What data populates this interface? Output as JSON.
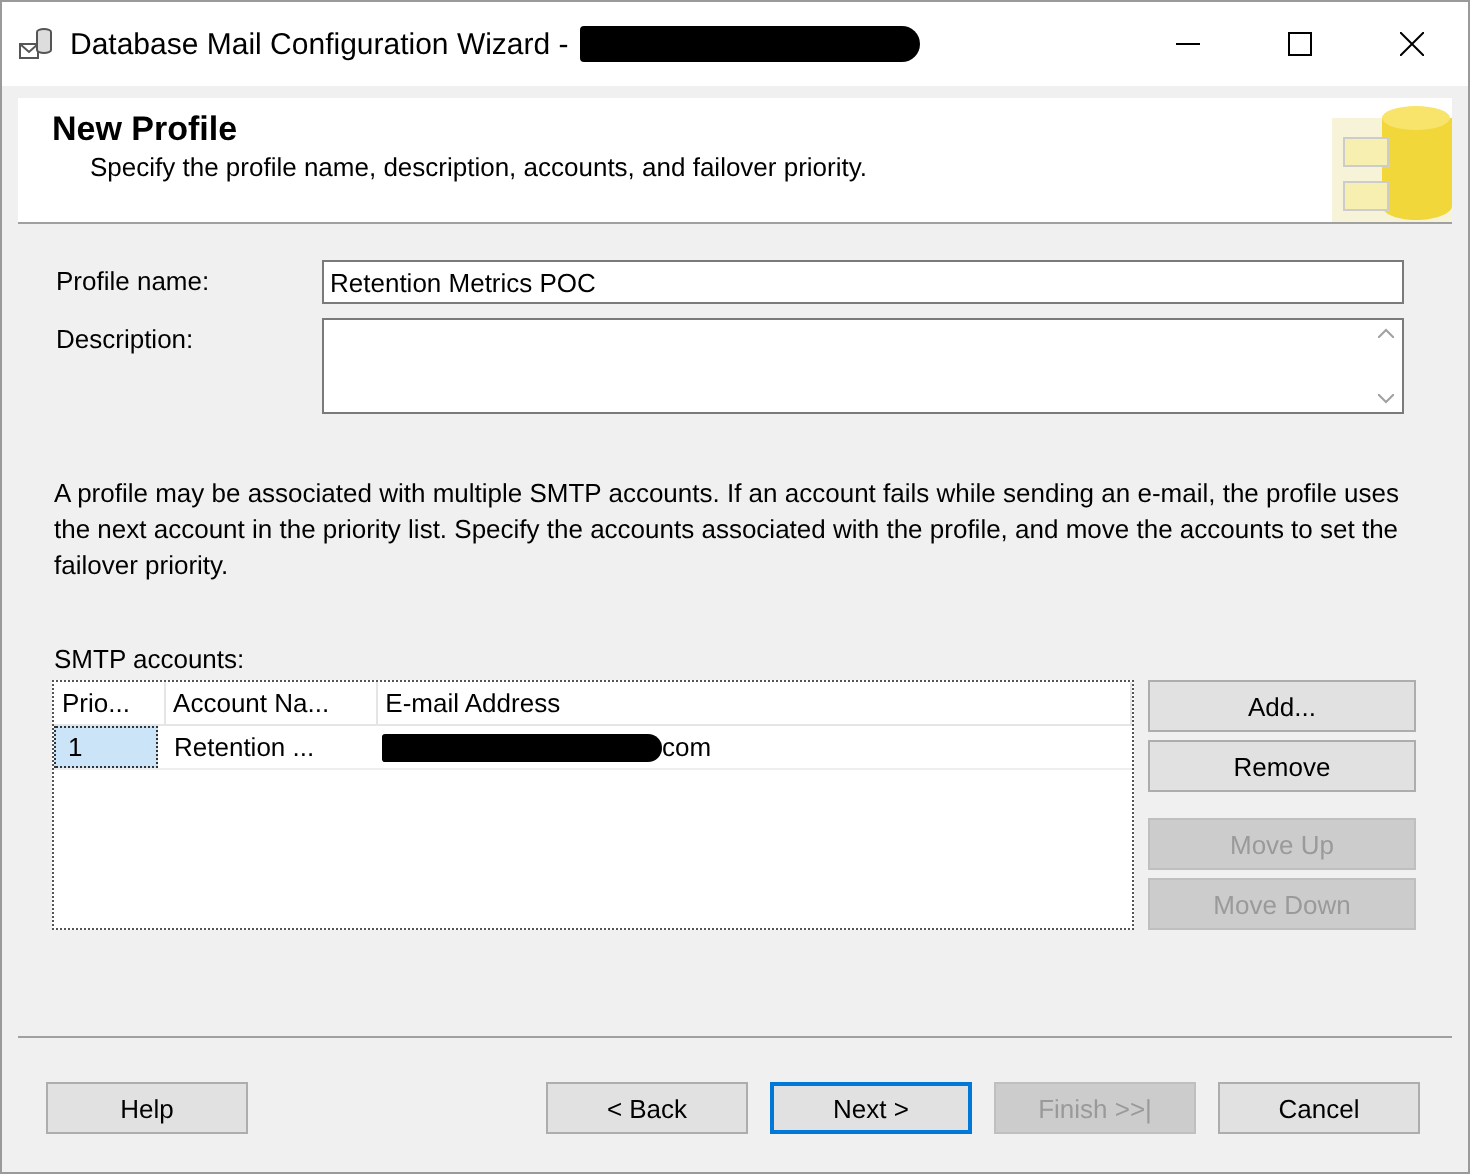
{
  "window": {
    "title": "Database Mail Configuration Wizard -"
  },
  "header": {
    "title": "New Profile",
    "subtitle": "Specify the profile name, description, accounts, and failover priority."
  },
  "profile_name": {
    "label": "Profile name:",
    "value": "Retention Metrics POC"
  },
  "description": {
    "label": "Description:"
  },
  "info": "A profile may be associated with multiple SMTP accounts. If an account fails while sending an e-mail, the profile uses the next account in the priority list. Specify the accounts associated with the profile, and move the accounts to set the failover priority.",
  "smtp": {
    "label": "SMTP accounts:",
    "columns": [
      "Prio...",
      "Account Na...",
      "E-mail Address"
    ],
    "rows": [
      {
        "priority": "1",
        "account": "Retention ...",
        "email": "com",
        "selected": true
      }
    ]
  },
  "side_buttons": [
    {
      "label": "Add...",
      "disabled": false
    },
    {
      "label": "Remove",
      "disabled": false
    },
    {
      "label": "Move Up",
      "disabled": true
    },
    {
      "label": "Move Down",
      "disabled": true
    }
  ],
  "footer_buttons": [
    {
      "label": "Help",
      "disabled": false,
      "default": false
    },
    {
      "label": "< Back",
      "disabled": false,
      "default": false
    },
    {
      "label": "Next >",
      "disabled": false,
      "default": true
    },
    {
      "label": "Finish >>|",
      "disabled": true,
      "default": false
    },
    {
      "label": "Cancel",
      "disabled": false,
      "default": false
    }
  ]
}
